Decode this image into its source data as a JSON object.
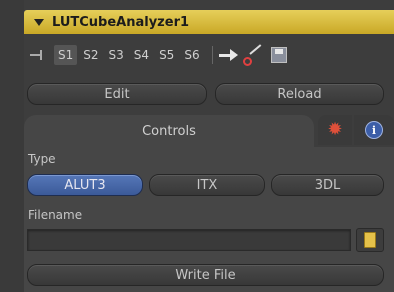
{
  "header": {
    "title": "LUTCubeAnalyzer1"
  },
  "toolbar": {
    "views": [
      "S1",
      "S2",
      "S3",
      "S4",
      "S5",
      "S6"
    ],
    "active_view": "S1"
  },
  "actions": {
    "edit_label": "Edit",
    "reload_label": "Reload"
  },
  "tabs": {
    "controls_label": "Controls"
  },
  "type_section": {
    "label": "Type",
    "options": [
      "ALUT3",
      "ITX",
      "3DL"
    ],
    "selected": "ALUT3"
  },
  "filename": {
    "label": "Filename",
    "value": ""
  },
  "write_file_label": "Write File"
}
